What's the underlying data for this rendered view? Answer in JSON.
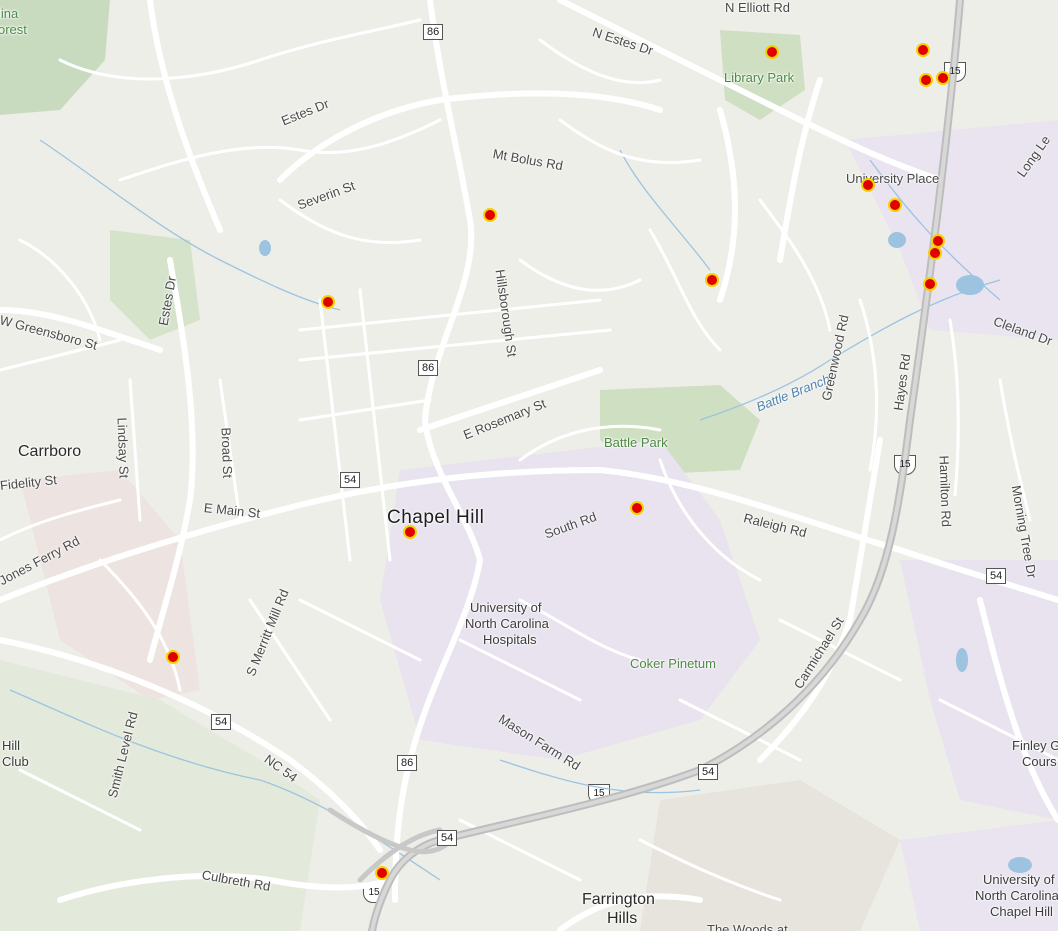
{
  "map": {
    "labels": {
      "carrboro": "Carrboro",
      "chapel_hill": "Chapel Hill",
      "library_park": "Library Park",
      "battle_park": "Battle Park",
      "coker_pinetum": "Coker Pinetum",
      "university_place": "University Place",
      "battle_branch": "Battle Branch",
      "farrington": "Farrington",
      "hills": "Hills",
      "unc_hosp_1": "University of",
      "unc_hosp_2": "North Carolina",
      "unc_hosp_3": "Hospitals",
      "unc_1": "University of",
      "unc_2": "North Carolina",
      "unc_3": "Chapel Hill",
      "finley_1": "Finley G",
      "finley_2": "Cours",
      "club_1": "Hill",
      "club_2": "Club",
      "forest_1": "lina",
      "forest_2": "orest",
      "woods": "The Woods at"
    },
    "roads": {
      "n_elliott": "N Elliott Rd",
      "n_estes": "N Estes Dr",
      "estes_dr": "Estes Dr",
      "estes_dr2": "Estes Dr",
      "severin": "Severin St",
      "mt_bolus": "Mt Bolus Rd",
      "hillsborough": "Hillsborough St",
      "w_greensboro": "W Greensboro St",
      "e_rosemary": "E Rosemary St",
      "lindsay": "Lindsay St",
      "broad": "Broad St",
      "fidelity": "Fidelity St",
      "e_main": "E Main St",
      "south_rd": "South Rd",
      "raleigh_rd": "Raleigh Rd",
      "greenwood": "Greenwood Rd",
      "hayes": "Hayes Rd",
      "hamilton": "Hamilton Rd",
      "cleland": "Cleland Dr",
      "long_leaf": "Long Le",
      "morning_tree": "Morning Tree Dr",
      "jones_ferry": "Jones Ferry Rd",
      "s_merritt": "S Merritt Mill Rd",
      "carmichael": "Carmichael St",
      "smith_level": "Smith Level Rd",
      "nc54": "NC 54",
      "mason_farm": "Mason Farm Rd",
      "culbreth": "Culbreth Rd"
    },
    "shields": {
      "s86_a": "86",
      "s86_b": "86",
      "s86_c": "86",
      "s54_a": "54",
      "s54_b": "54",
      "s54_c": "54",
      "s54_d": "54",
      "s54_e": "54",
      "us15_a": "15",
      "us15_b": "15",
      "us15_c": "15",
      "us15_d": "15"
    },
    "markers": 17,
    "colors": {
      "background": "#eeeee8",
      "park": "#cfdfc2",
      "institution": "#e8e3ee",
      "water": "#9cc3e0",
      "marker_fill": "#e00000",
      "marker_ring": "#f4d200",
      "road": "#ffffff",
      "highway": "#c4c4c4"
    }
  }
}
